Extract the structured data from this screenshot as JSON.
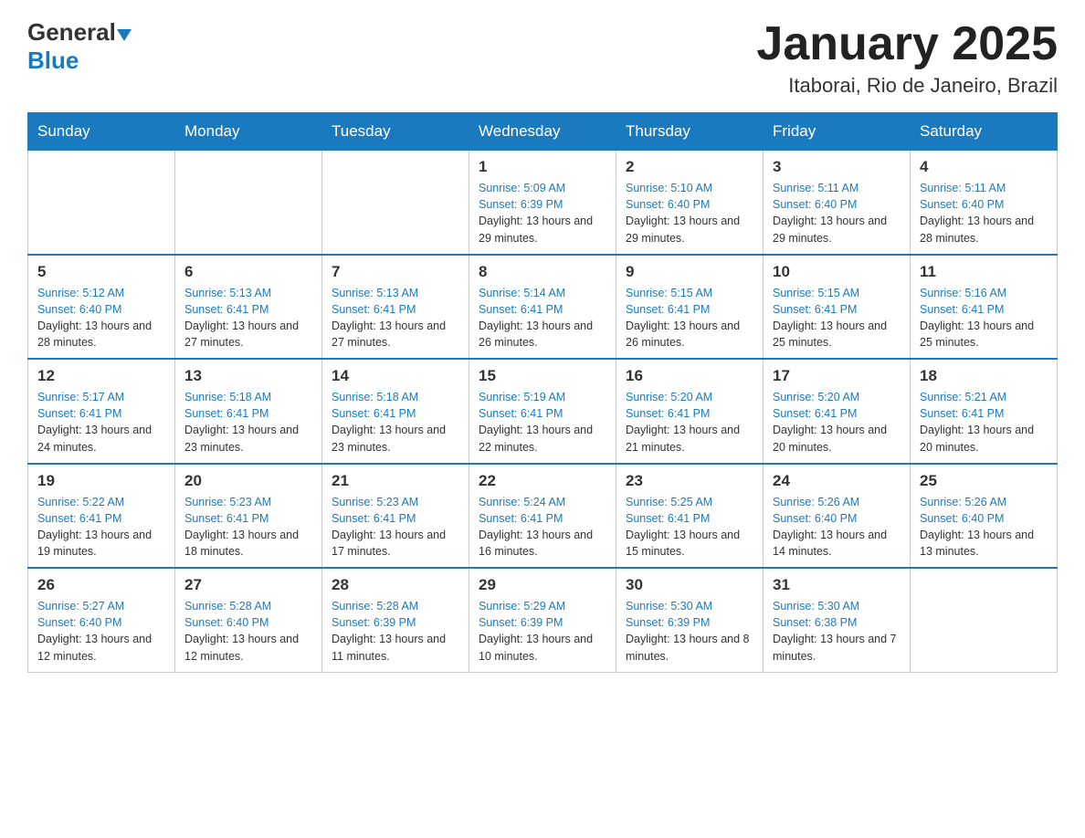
{
  "header": {
    "logo": {
      "general": "General",
      "blue": "Blue"
    },
    "title": "January 2025",
    "location": "Itaborai, Rio de Janeiro, Brazil"
  },
  "weekdays": [
    "Sunday",
    "Monday",
    "Tuesday",
    "Wednesday",
    "Thursday",
    "Friday",
    "Saturday"
  ],
  "weeks": [
    [
      {
        "day": "",
        "sunrise": "",
        "sunset": "",
        "daylight": ""
      },
      {
        "day": "",
        "sunrise": "",
        "sunset": "",
        "daylight": ""
      },
      {
        "day": "",
        "sunrise": "",
        "sunset": "",
        "daylight": ""
      },
      {
        "day": "1",
        "sunrise": "Sunrise: 5:09 AM",
        "sunset": "Sunset: 6:39 PM",
        "daylight": "Daylight: 13 hours and 29 minutes."
      },
      {
        "day": "2",
        "sunrise": "Sunrise: 5:10 AM",
        "sunset": "Sunset: 6:40 PM",
        "daylight": "Daylight: 13 hours and 29 minutes."
      },
      {
        "day": "3",
        "sunrise": "Sunrise: 5:11 AM",
        "sunset": "Sunset: 6:40 PM",
        "daylight": "Daylight: 13 hours and 29 minutes."
      },
      {
        "day": "4",
        "sunrise": "Sunrise: 5:11 AM",
        "sunset": "Sunset: 6:40 PM",
        "daylight": "Daylight: 13 hours and 28 minutes."
      }
    ],
    [
      {
        "day": "5",
        "sunrise": "Sunrise: 5:12 AM",
        "sunset": "Sunset: 6:40 PM",
        "daylight": "Daylight: 13 hours and 28 minutes."
      },
      {
        "day": "6",
        "sunrise": "Sunrise: 5:13 AM",
        "sunset": "Sunset: 6:41 PM",
        "daylight": "Daylight: 13 hours and 27 minutes."
      },
      {
        "day": "7",
        "sunrise": "Sunrise: 5:13 AM",
        "sunset": "Sunset: 6:41 PM",
        "daylight": "Daylight: 13 hours and 27 minutes."
      },
      {
        "day": "8",
        "sunrise": "Sunrise: 5:14 AM",
        "sunset": "Sunset: 6:41 PM",
        "daylight": "Daylight: 13 hours and 26 minutes."
      },
      {
        "day": "9",
        "sunrise": "Sunrise: 5:15 AM",
        "sunset": "Sunset: 6:41 PM",
        "daylight": "Daylight: 13 hours and 26 minutes."
      },
      {
        "day": "10",
        "sunrise": "Sunrise: 5:15 AM",
        "sunset": "Sunset: 6:41 PM",
        "daylight": "Daylight: 13 hours and 25 minutes."
      },
      {
        "day": "11",
        "sunrise": "Sunrise: 5:16 AM",
        "sunset": "Sunset: 6:41 PM",
        "daylight": "Daylight: 13 hours and 25 minutes."
      }
    ],
    [
      {
        "day": "12",
        "sunrise": "Sunrise: 5:17 AM",
        "sunset": "Sunset: 6:41 PM",
        "daylight": "Daylight: 13 hours and 24 minutes."
      },
      {
        "day": "13",
        "sunrise": "Sunrise: 5:18 AM",
        "sunset": "Sunset: 6:41 PM",
        "daylight": "Daylight: 13 hours and 23 minutes."
      },
      {
        "day": "14",
        "sunrise": "Sunrise: 5:18 AM",
        "sunset": "Sunset: 6:41 PM",
        "daylight": "Daylight: 13 hours and 23 minutes."
      },
      {
        "day": "15",
        "sunrise": "Sunrise: 5:19 AM",
        "sunset": "Sunset: 6:41 PM",
        "daylight": "Daylight: 13 hours and 22 minutes."
      },
      {
        "day": "16",
        "sunrise": "Sunrise: 5:20 AM",
        "sunset": "Sunset: 6:41 PM",
        "daylight": "Daylight: 13 hours and 21 minutes."
      },
      {
        "day": "17",
        "sunrise": "Sunrise: 5:20 AM",
        "sunset": "Sunset: 6:41 PM",
        "daylight": "Daylight: 13 hours and 20 minutes."
      },
      {
        "day": "18",
        "sunrise": "Sunrise: 5:21 AM",
        "sunset": "Sunset: 6:41 PM",
        "daylight": "Daylight: 13 hours and 20 minutes."
      }
    ],
    [
      {
        "day": "19",
        "sunrise": "Sunrise: 5:22 AM",
        "sunset": "Sunset: 6:41 PM",
        "daylight": "Daylight: 13 hours and 19 minutes."
      },
      {
        "day": "20",
        "sunrise": "Sunrise: 5:23 AM",
        "sunset": "Sunset: 6:41 PM",
        "daylight": "Daylight: 13 hours and 18 minutes."
      },
      {
        "day": "21",
        "sunrise": "Sunrise: 5:23 AM",
        "sunset": "Sunset: 6:41 PM",
        "daylight": "Daylight: 13 hours and 17 minutes."
      },
      {
        "day": "22",
        "sunrise": "Sunrise: 5:24 AM",
        "sunset": "Sunset: 6:41 PM",
        "daylight": "Daylight: 13 hours and 16 minutes."
      },
      {
        "day": "23",
        "sunrise": "Sunrise: 5:25 AM",
        "sunset": "Sunset: 6:41 PM",
        "daylight": "Daylight: 13 hours and 15 minutes."
      },
      {
        "day": "24",
        "sunrise": "Sunrise: 5:26 AM",
        "sunset": "Sunset: 6:40 PM",
        "daylight": "Daylight: 13 hours and 14 minutes."
      },
      {
        "day": "25",
        "sunrise": "Sunrise: 5:26 AM",
        "sunset": "Sunset: 6:40 PM",
        "daylight": "Daylight: 13 hours and 13 minutes."
      }
    ],
    [
      {
        "day": "26",
        "sunrise": "Sunrise: 5:27 AM",
        "sunset": "Sunset: 6:40 PM",
        "daylight": "Daylight: 13 hours and 12 minutes."
      },
      {
        "day": "27",
        "sunrise": "Sunrise: 5:28 AM",
        "sunset": "Sunset: 6:40 PM",
        "daylight": "Daylight: 13 hours and 12 minutes."
      },
      {
        "day": "28",
        "sunrise": "Sunrise: 5:28 AM",
        "sunset": "Sunset: 6:39 PM",
        "daylight": "Daylight: 13 hours and 11 minutes."
      },
      {
        "day": "29",
        "sunrise": "Sunrise: 5:29 AM",
        "sunset": "Sunset: 6:39 PM",
        "daylight": "Daylight: 13 hours and 10 minutes."
      },
      {
        "day": "30",
        "sunrise": "Sunrise: 5:30 AM",
        "sunset": "Sunset: 6:39 PM",
        "daylight": "Daylight: 13 hours and 8 minutes."
      },
      {
        "day": "31",
        "sunrise": "Sunrise: 5:30 AM",
        "sunset": "Sunset: 6:38 PM",
        "daylight": "Daylight: 13 hours and 7 minutes."
      },
      {
        "day": "",
        "sunrise": "",
        "sunset": "",
        "daylight": ""
      }
    ]
  ]
}
